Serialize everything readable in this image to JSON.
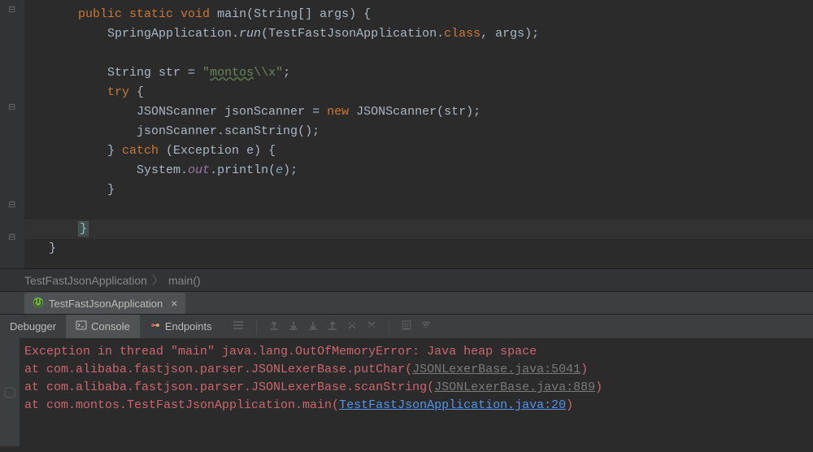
{
  "code": {
    "lines": [
      {
        "indent": "    ",
        "tokens": [
          {
            "t": "public ",
            "c": "kw"
          },
          {
            "t": "static ",
            "c": "kw"
          },
          {
            "t": "void ",
            "c": "kw"
          },
          {
            "t": "main",
            "c": "plain"
          },
          {
            "t": "(",
            "c": "plain"
          },
          {
            "t": "String",
            "c": "plain"
          },
          {
            "t": "[] args) ",
            "c": "plain"
          },
          {
            "t": "{",
            "c": "plain"
          }
        ]
      },
      {
        "indent": "        ",
        "tokens": [
          {
            "t": "SpringApplication.",
            "c": "plain"
          },
          {
            "t": "run",
            "c": "plain",
            "italic": true
          },
          {
            "t": "(TestFastJsonApplication.",
            "c": "plain"
          },
          {
            "t": "class",
            "c": "kw"
          },
          {
            "t": ", args);",
            "c": "plain"
          }
        ]
      },
      {
        "indent": "",
        "tokens": []
      },
      {
        "indent": "        ",
        "tokens": [
          {
            "t": "String str = ",
            "c": "plain"
          },
          {
            "t": "\"",
            "c": "str"
          },
          {
            "t": "montos",
            "c": "str",
            "u": true
          },
          {
            "t": "\\\\x",
            "c": "str"
          },
          {
            "t": "\"",
            "c": "str"
          },
          {
            "t": ";",
            "c": "plain"
          }
        ]
      },
      {
        "indent": "        ",
        "tokens": [
          {
            "t": "try ",
            "c": "kw"
          },
          {
            "t": "{",
            "c": "plain"
          }
        ]
      },
      {
        "indent": "            ",
        "tokens": [
          {
            "t": "JSONScanner jsonScanner = ",
            "c": "plain"
          },
          {
            "t": "new ",
            "c": "kw"
          },
          {
            "t": "JSONScanner(str);",
            "c": "plain"
          }
        ]
      },
      {
        "indent": "            ",
        "tokens": [
          {
            "t": "jsonScanner.scanString();",
            "c": "plain"
          }
        ]
      },
      {
        "indent": "        ",
        "tokens": [
          {
            "t": "} ",
            "c": "plain"
          },
          {
            "t": "catch ",
            "c": "kw"
          },
          {
            "t": "(Exception e) {",
            "c": "plain"
          }
        ]
      },
      {
        "indent": "            ",
        "tokens": [
          {
            "t": "System.",
            "c": "plain"
          },
          {
            "t": "out",
            "c": "field"
          },
          {
            "t": ".println(",
            "c": "plain"
          },
          {
            "t": "e",
            "c": "paramname"
          },
          {
            "t": ");",
            "c": "plain"
          }
        ]
      },
      {
        "indent": "        ",
        "tokens": [
          {
            "t": "}",
            "c": "plain"
          }
        ]
      },
      {
        "indent": "",
        "tokens": []
      },
      {
        "indent": "    ",
        "tokens": [
          {
            "t": "}",
            "c": "plain",
            "caret": true
          }
        ],
        "current": true
      },
      {
        "indent": "",
        "tokens": [
          {
            "t": "}",
            "c": "plain"
          }
        ]
      }
    ]
  },
  "breadcrumb": {
    "class": "TestFastJsonApplication",
    "method": "main()"
  },
  "run_tab": {
    "label": "TestFastJsonApplication"
  },
  "debug_tabs": {
    "debugger": "Debugger",
    "console": "Console",
    "endpoints": "Endpoints"
  },
  "console_output": {
    "line1_a": "Exception in thread \"main\" ",
    "line1_b": "java.lang.OutOfMemoryError: Java heap space",
    "line2_a": "    at com.alibaba.fastjson.parser.JSONLexerBase.putChar(",
    "line2_link": "JSONLexerBase.java:5041",
    "line2_b": ")",
    "line3_a": "    at com.alibaba.fastjson.parser.JSONLexerBase.scanString(",
    "line3_link": "JSONLexerBase.java:889",
    "line3_b": ")",
    "line4_a": "    at com.montos.TestFastJsonApplication.main(",
    "line4_link": "TestFastJsonApplication.java:20",
    "line4_b": ")"
  }
}
